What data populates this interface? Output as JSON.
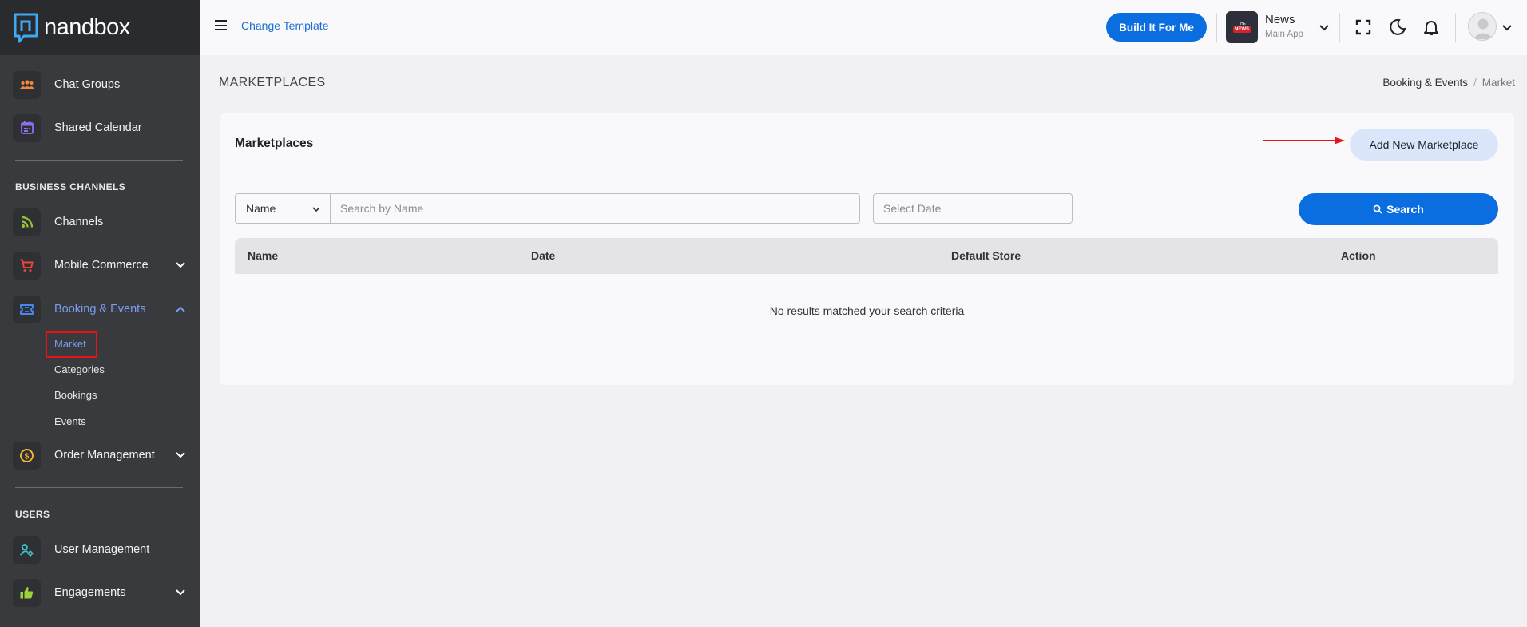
{
  "brand": {
    "name": "nandbox"
  },
  "sidebar": {
    "items_top": [
      {
        "label": "Chat Groups",
        "icon": "people-icon"
      },
      {
        "label": "Shared Calendar",
        "icon": "calendar-icon"
      }
    ],
    "section_business": "BUSINESS CHANNELS",
    "business_items": [
      {
        "label": "Channels",
        "icon": "rss-icon"
      },
      {
        "label": "Mobile Commerce",
        "icon": "cart-icon"
      },
      {
        "label": "Booking & Events",
        "icon": "ticket-icon"
      }
    ],
    "booking_sub": [
      "Market",
      "Categories",
      "Bookings",
      "Events"
    ],
    "order_management": "Order Management",
    "section_users": "USERS",
    "user_items": [
      {
        "label": "User Management",
        "icon": "user-gear-icon"
      },
      {
        "label": "Engagements",
        "icon": "thumbs-up-icon"
      }
    ]
  },
  "topbar": {
    "change_template": "Change Template",
    "build_button": "Build It For Me",
    "app_name": "News",
    "app_subtitle": "Main App",
    "thumb_line1": "THE",
    "thumb_badge": "NEWS"
  },
  "page": {
    "heading": "MARKETPLACES",
    "breadcrumb": [
      "Booking & Events",
      "Market"
    ]
  },
  "card": {
    "title": "Marketplaces",
    "add_button": "Add New Marketplace",
    "filter_select": "Name",
    "search_placeholder": "Search by Name",
    "date_placeholder": "Select Date",
    "search_button": "Search",
    "columns": [
      "Name",
      "Date",
      "Default Store",
      "Action"
    ],
    "empty_message": "No results matched your search criteria"
  },
  "colors": {
    "sidebar_bg": "#393a3d",
    "accent_blue": "#0a6ee0",
    "active_link": "#7c9cf0",
    "highlight_red": "#e3141b"
  }
}
